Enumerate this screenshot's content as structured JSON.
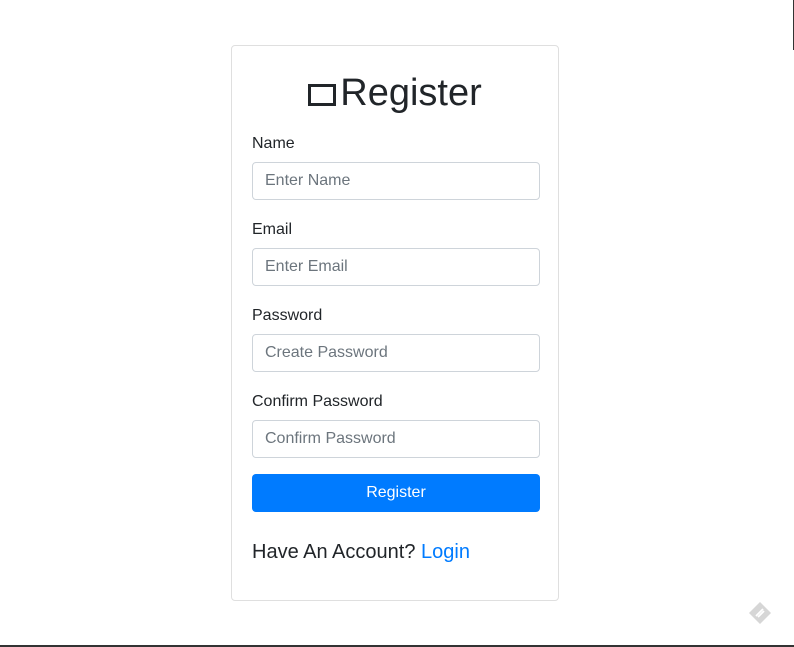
{
  "form": {
    "title": "Register",
    "fields": [
      {
        "label": "Name",
        "placeholder": "Enter Name",
        "value": ""
      },
      {
        "label": "Email",
        "placeholder": "Enter Email",
        "value": ""
      },
      {
        "label": "Password",
        "placeholder": "Create Password",
        "value": ""
      },
      {
        "label": "Confirm Password",
        "placeholder": "Confirm Password",
        "value": ""
      }
    ],
    "submit_label": "Register",
    "account_prompt": "Have An Account?",
    "login_link": "Login"
  },
  "colors": {
    "primary": "#007bff",
    "text": "#212529",
    "border": "#ced4da",
    "placeholder": "#6c757d"
  },
  "icons": {
    "title_icon": "square-outline-icon",
    "corner_icon": "feedback-icon"
  }
}
